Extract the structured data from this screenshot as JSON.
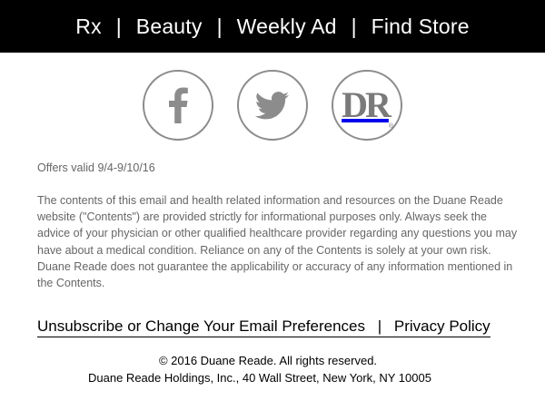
{
  "nav": {
    "items": [
      {
        "label": "Rx"
      },
      {
        "label": "Beauty"
      },
      {
        "label": "Weekly Ad"
      },
      {
        "label": "Find Store"
      }
    ],
    "separator": "|"
  },
  "social": {
    "icons": [
      "facebook-icon",
      "twitter-icon",
      "duane-reade-logo"
    ],
    "logo_letters": "DR",
    "logo_mark": "®",
    "icon_color": "#8c8c8c"
  },
  "offers": {
    "text": "Offers valid 9/4-9/10/16"
  },
  "disclaimer": {
    "text": "The contents of this email and health related information and resources on the Duane Reade website (\"Contents\") are provided strictly for informational purposes only. Always seek the advice of your physician or other qualified healthcare provider regarding any questions you may have about a medical condition. Reliance on any of the Contents is solely at your own risk. Duane Reade does not guarantee the applicability or accuracy of any information mentioned in the Contents."
  },
  "links": {
    "unsubscribe": "Unsubscribe or Change Your Email Preferences",
    "separator": "|",
    "privacy": "Privacy Policy"
  },
  "footer": {
    "copyright": "© 2016 Duane Reade. All rights reserved.",
    "address": "Duane Reade Holdings, Inc., 40 Wall Street, New York, NY 10005"
  }
}
